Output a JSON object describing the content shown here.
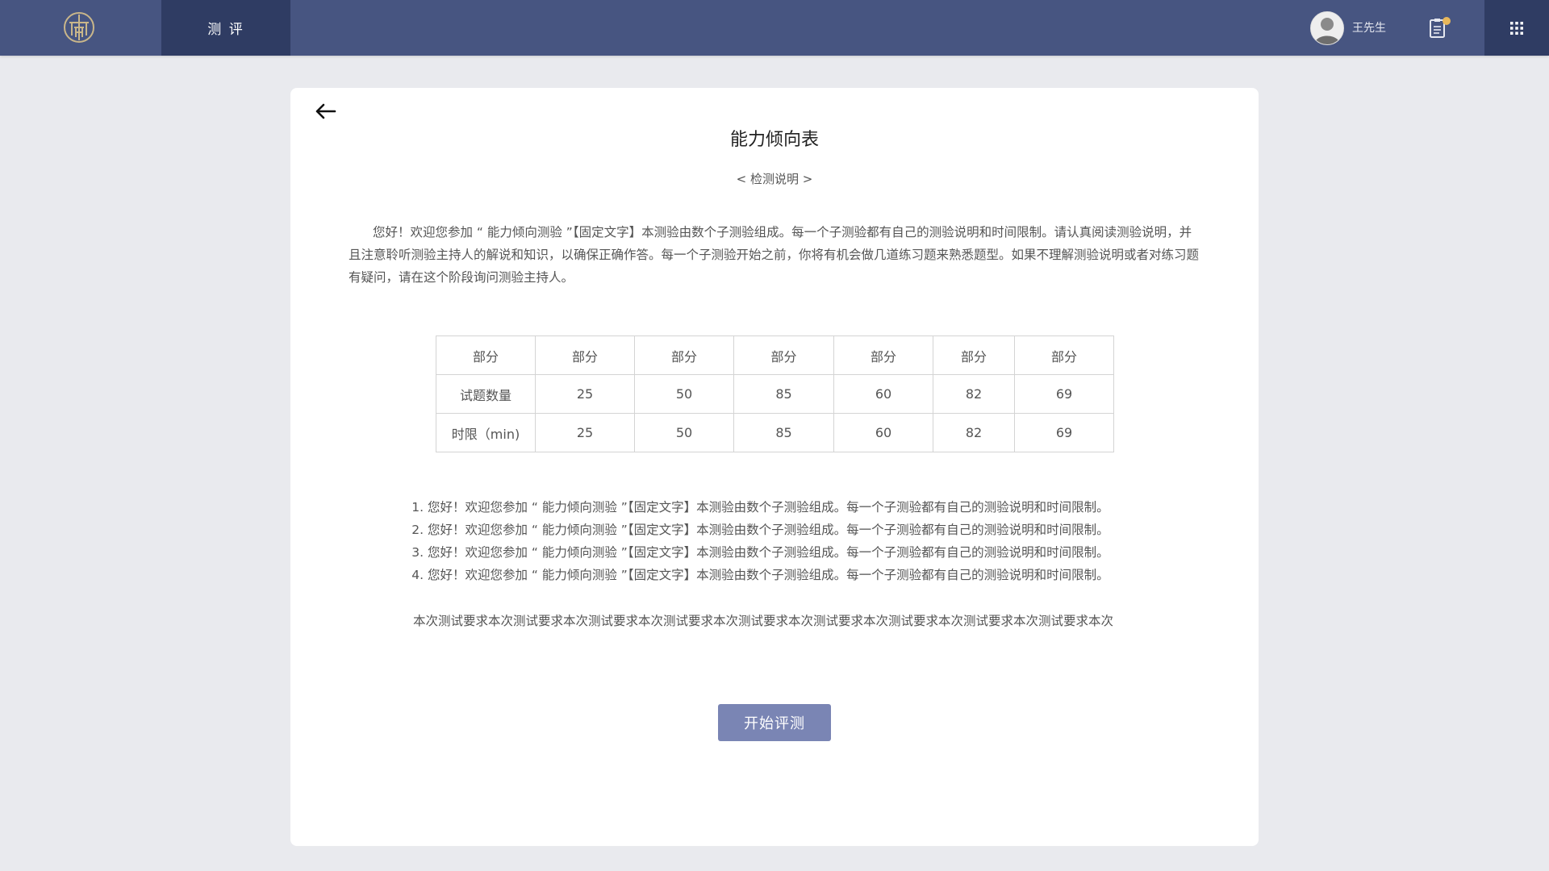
{
  "header": {
    "nav_tab_label": "测 评",
    "username": "王先生",
    "notice_badge_color": "#e8b75a",
    "bar_color": "#475581",
    "active_color": "#2f3c63"
  },
  "icons": {
    "logo": "brand-logo-icon",
    "avatar": "user-avatar",
    "notice": "clipboard-icon",
    "apps": "grid-menu-icon",
    "back": "arrow-left-icon"
  },
  "page": {
    "title": "能力倾向表",
    "subtitle": "< 检测说明 >",
    "intro": "您好！欢迎您参加 “ 能力倾向测验 ”【固定文字】本测验由数个子测验组成。每一个子测验都有自己的测验说明和时间限制。请认真阅读测验说明，并且注意聆听测验主持人的解说和知识，以确保正确作答。每一个子测验开始之前，你将有机会做几道练习题来熟悉题型。如果不理解测验说明或者对练习题有疑问，请在这个阶段询问测验主持人。"
  },
  "table": {
    "header": [
      "部分",
      "部分",
      "部分",
      "部分",
      "部分",
      "部分",
      "部分"
    ],
    "rows": [
      [
        "试题数量",
        "25",
        "50",
        "85",
        "60",
        "82",
        "69"
      ],
      [
        "时限（min)",
        "25",
        "50",
        "85",
        "60",
        "82",
        "69"
      ]
    ]
  },
  "rules": [
    "您好！欢迎您参加 “ 能力倾向测验 ”【固定文字】本测验由数个子测验组成。每一个子测验都有自己的测验说明和时间限制。",
    "您好！欢迎您参加 “ 能力倾向测验 ”【固定文字】本测验由数个子测验组成。每一个子测验都有自己的测验说明和时间限制。",
    "您好！欢迎您参加 “ 能力倾向测验 ”【固定文字】本测验由数个子测验组成。每一个子测验都有自己的测验说明和时间限制。",
    "您好！欢迎您参加 “ 能力倾向测验 ”【固定文字】本测验由数个子测验组成。每一个子测验都有自己的测验说明和时间限制。"
  ],
  "requirement": "本次测试要求本次测试要求本次测试要求本次测试要求本次测试要求本次测试要求本次测试要求本次测试要求本次测试要求本次",
  "start_button": "开始评测"
}
